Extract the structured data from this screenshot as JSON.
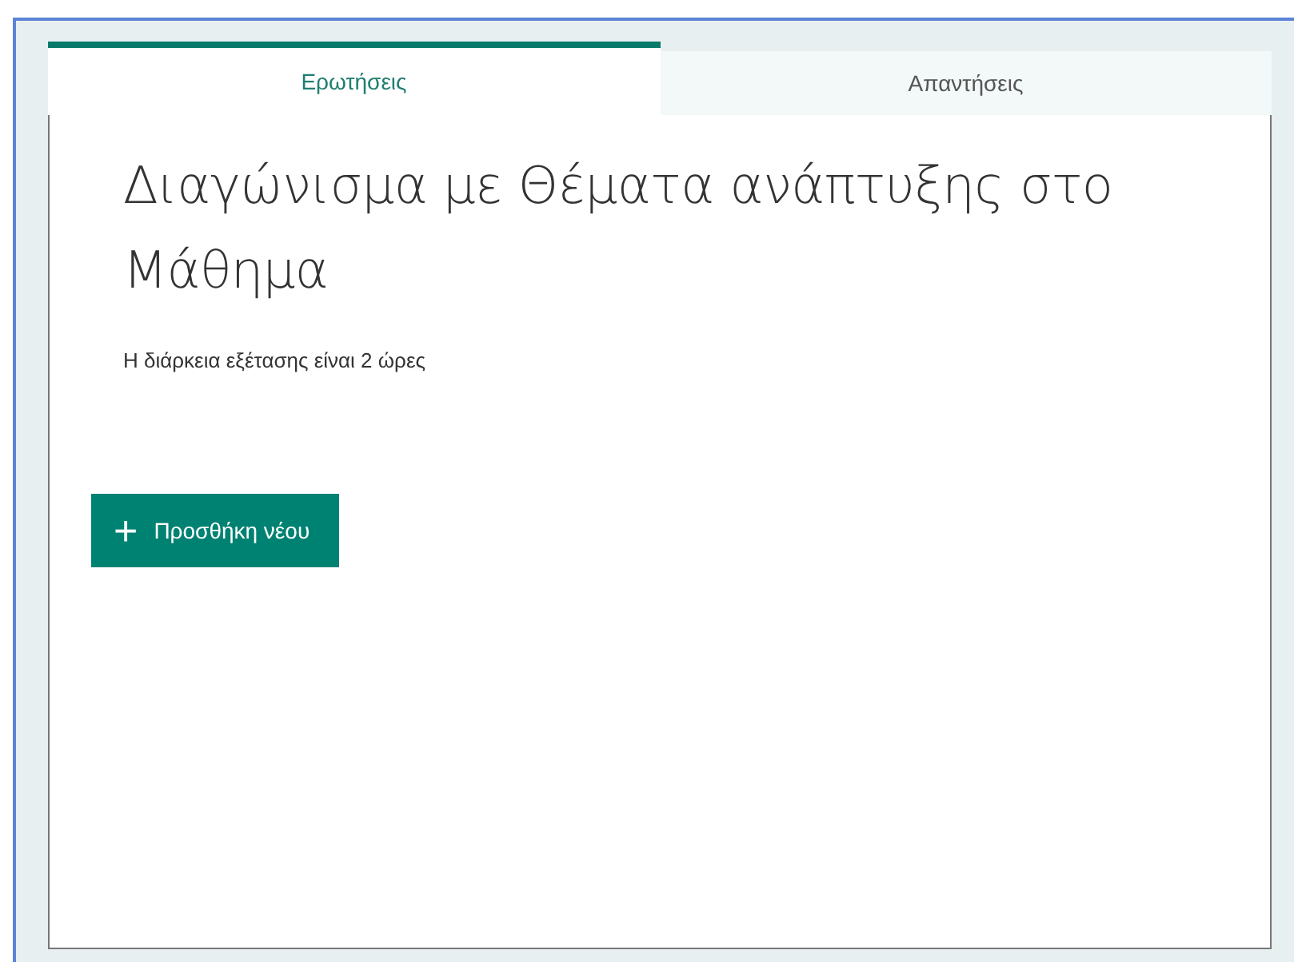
{
  "tabs": [
    {
      "label": "Ερωτήσεις",
      "selected": true
    },
    {
      "label": "Απαντήσεις",
      "selected": false
    }
  ],
  "form": {
    "title": "Διαγώνισμα με Θέματα ανάπτυξης στο Μάθημα",
    "description": "Η διάρκεια εξέτασης είναι 2 ώρες"
  },
  "add_button": {
    "icon": "+",
    "label": "Προσθήκη νέου"
  }
}
